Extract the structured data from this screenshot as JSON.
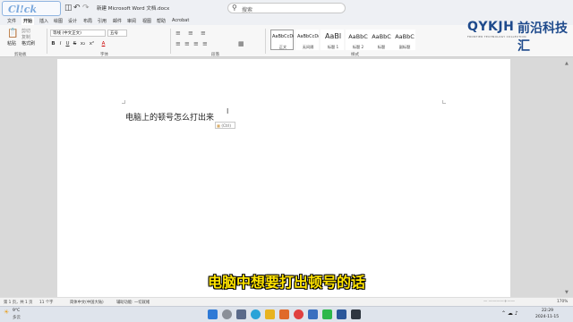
{
  "window": {
    "title": "新建 Microsoft Word 文档.docx",
    "watermark_logo": "Cl!ck",
    "search_placeholder": "搜索",
    "icons": [
      "save-icon",
      "undo-icon",
      "redo-icon",
      "search-icon"
    ]
  },
  "menu": [
    "文件",
    "开始",
    "插入",
    "绘图",
    "设计",
    "布局",
    "引用",
    "邮件",
    "审阅",
    "视图",
    "帮助",
    "Acrobat"
  ],
  "menu_active_index": 1,
  "ribbon": {
    "clipboard": {
      "paste": "粘贴",
      "cut": "剪切",
      "copy": "复制",
      "format_painter": "格式刷",
      "group": "剪贴板"
    },
    "font": {
      "font_name": "等线 (中文正文)",
      "font_size": "五号",
      "group": "字体",
      "buttons": [
        "B",
        "I",
        "U",
        "S",
        "x₂",
        "x²",
        "A"
      ]
    },
    "paragraph": {
      "group": "段落"
    },
    "styles": {
      "group": "样式",
      "tiles": [
        {
          "preview": "AaBbCcDc",
          "name": "正文",
          "selected": true
        },
        {
          "preview": "AaBbCcDc",
          "name": "无间隔",
          "selected": false
        },
        {
          "preview": "AaBl",
          "name": "标题 1",
          "selected": false
        },
        {
          "preview": "AaBbC",
          "name": "标题 2",
          "selected": false
        },
        {
          "preview": "AaBbC",
          "name": "标题",
          "selected": false
        },
        {
          "preview": "AaBbC",
          "name": "副标题",
          "selected": false
        }
      ]
    }
  },
  "brand": {
    "latin": "QYKJH",
    "chinese": "前沿科技汇",
    "tagline": "FRONTIER TECHNOLOGY COLLECTION"
  },
  "document": {
    "body_text": "电脑上的顿号怎么打出来",
    "paste_options": "(Ctrl)"
  },
  "subtitle": "电脑中想要打出顿号的话",
  "status": {
    "page": "第 1 页，共 1 页",
    "words": "11 个字",
    "language": "简体中文(中国大陆)",
    "accessibility": "辅助功能: 一切就绪",
    "zoom": "170%"
  },
  "taskbar": {
    "weather": "9°C",
    "weather_desc": "多云",
    "time": "22:29",
    "date": "2024-11-15"
  }
}
